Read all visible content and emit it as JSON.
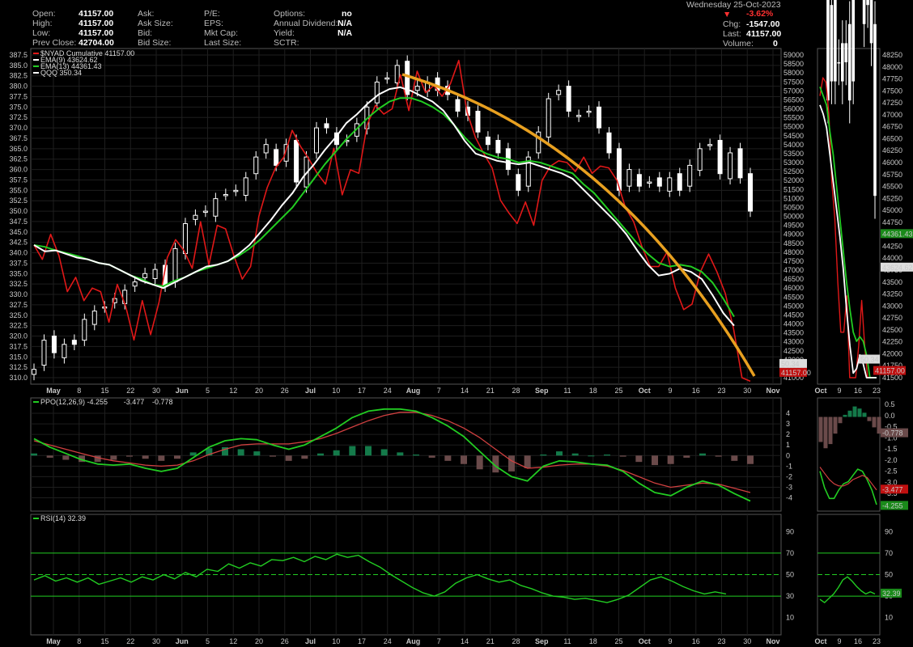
{
  "header": {
    "fields": [
      {
        "label": "Open:",
        "value": "41157.00"
      },
      {
        "label": "High:",
        "value": "41157.00"
      },
      {
        "label": "Low:",
        "value": "41157.00"
      },
      {
        "label": "Prev Close:",
        "value": "42704.00"
      },
      {
        "label": "Ask:",
        "value": ""
      },
      {
        "label": "Ask Size:",
        "value": ""
      },
      {
        "label": "Bid:",
        "value": ""
      },
      {
        "label": "Bid Size:",
        "value": ""
      },
      {
        "label": "P/E:",
        "value": ""
      },
      {
        "label": "EPS:",
        "value": ""
      },
      {
        "label": "Mkt Cap:",
        "value": ""
      },
      {
        "label": "Last Size:",
        "value": ""
      },
      {
        "label": "Options:",
        "value": "no"
      },
      {
        "label": "Annual Dividend:",
        "value": "N/A"
      },
      {
        "label": "Yield:",
        "value": "N/A"
      },
      {
        "label": "SCTR:",
        "value": ""
      }
    ],
    "date": "Wednesday  25-Oct-2023",
    "change_pct": "-3.62%",
    "chg_label": "Chg:",
    "chg_value": "-1547.00",
    "last_label": "Last:",
    "last_value": "41157.00",
    "volume_label": "Volume:",
    "volume_value": "0",
    "down_color": "#ff3030"
  },
  "chart_data": [
    {
      "type": "line",
      "legend": [
        {
          "name": "$NYAD Cumulative 41157.00",
          "color": "#e01818"
        },
        {
          "name": "EMA(9) 43624.62",
          "color": "#ffffff"
        },
        {
          "name": "EMA(13) 44361.43",
          "color": "#22cc22"
        },
        {
          "name": "QQQ 350.34",
          "color": "#ffffff"
        }
      ],
      "x_labels": [
        "May",
        "8",
        "15",
        "22",
        "30",
        "Jun",
        "5",
        "12",
        "20",
        "26",
        "Jul",
        "10",
        "17",
        "24",
        "Aug",
        "7",
        "14",
        "21",
        "28",
        "Sep",
        "11",
        "18",
        "25",
        "Oct",
        "9",
        "16",
        "23",
        "30",
        "Nov"
      ],
      "left_axis": {
        "ylim": [
          310.0,
          387.5
        ],
        "ticks": [
          "387.5",
          "385.0",
          "382.5",
          "380.0",
          "377.5",
          "375.0",
          "372.5",
          "370.0",
          "367.5",
          "365.0",
          "362.5",
          "360.0",
          "357.5",
          "355.0",
          "352.5",
          "350.0",
          "347.5",
          "345.0",
          "342.5",
          "340.0",
          "337.5",
          "335.0",
          "332.5",
          "330.0",
          "327.5",
          "325.0",
          "322.5",
          "320.0",
          "317.5",
          "315.0",
          "312.5",
          "310.0"
        ]
      },
      "right_axis": {
        "ylim": [
          41000,
          59000
        ],
        "ticks": [
          "59000",
          "58500",
          "58000",
          "57500",
          "57000",
          "56500",
          "56000",
          "55500",
          "55000",
          "54500",
          "54000",
          "53500",
          "53000",
          "52500",
          "52000",
          "51500",
          "51000",
          "50500",
          "50000",
          "49500",
          "49000",
          "48500",
          "48000",
          "47500",
          "47000",
          "46500",
          "46000",
          "45500",
          "45000",
          "44500",
          "44000",
          "43500",
          "43000",
          "42500",
          "42000",
          "41500",
          "41000"
        ]
      },
      "nyad_markers": [
        "50.34",
        "41157.00"
      ],
      "series": [
        {
          "name": "$NYAD Cumulative",
          "values": [
            48400,
            47600,
            49000,
            47800,
            45800,
            46600,
            45300,
            46000,
            45800,
            44100,
            46200,
            45000,
            43100,
            45300,
            43400,
            45200,
            47700,
            48700,
            48100,
            47100,
            49700,
            47300,
            49500,
            49300,
            47800,
            46500,
            47200,
            50000,
            51600,
            52700,
            53300,
            54800,
            53900,
            53200,
            52400,
            51800,
            53800,
            51200,
            52600,
            52400,
            55100,
            56200,
            55700,
            56000,
            57900,
            55900,
            58100,
            56900,
            57300,
            56700,
            57400,
            58700,
            55800,
            54400,
            53500,
            52700,
            50900,
            50200,
            49600,
            50800,
            49500,
            52000,
            52800,
            53100,
            53000,
            52500,
            53300,
            52400,
            52800,
            52700,
            52000,
            50500,
            49700,
            48300,
            47200,
            47200,
            48000,
            46000,
            44800,
            45100,
            46900,
            47900,
            46900,
            45700,
            43700,
            41000,
            40800
          ],
          "color": "#e01818"
        },
        {
          "name": "EMA(9)",
          "values": [
            48400,
            48050,
            48100,
            47900,
            47700,
            47600,
            47400,
            47300,
            47000,
            46700,
            46400,
            46200,
            46000,
            46300,
            46600,
            46900,
            47200,
            47300,
            47500,
            47900,
            48400,
            49100,
            49800,
            50600,
            51300,
            52200,
            52900,
            53700,
            54400,
            55200,
            55700,
            56300,
            56800,
            57100,
            57200,
            57000,
            56700,
            56400,
            55900,
            55100,
            54200,
            53500,
            53300,
            53100,
            53000,
            52900,
            53000,
            52800,
            52600,
            52400,
            52100,
            51500,
            50900,
            50300,
            49700,
            49000,
            48100,
            47300,
            46700,
            46800,
            47100,
            46900,
            46500,
            45600,
            44600,
            43900
          ],
          "color": "#ffffff"
        },
        {
          "name": "EMA(13)",
          "values": [
            48400,
            48300,
            48100,
            47950,
            47800,
            47600,
            47400,
            47300,
            47000,
            46700,
            46500,
            46200,
            46100,
            46400,
            46600,
            46900,
            47100,
            47300,
            47500,
            47800,
            48200,
            48700,
            49300,
            49900,
            50500,
            51300,
            52100,
            52900,
            53600,
            54300,
            54900,
            55500,
            56000,
            56400,
            56600,
            56600,
            56400,
            56100,
            55700,
            55100,
            54400,
            53800,
            53500,
            53300,
            53200,
            53000,
            53100,
            53000,
            52800,
            52600,
            52400,
            51800,
            51300,
            50600,
            49900,
            49200,
            48500,
            47900,
            47400,
            47200,
            47300,
            47200,
            46900,
            46300,
            45400,
            44400
          ],
          "color": "#22cc22"
        },
        {
          "name": "QQQ",
          "type": "candlestick",
          "close": [
            312,
            319,
            316,
            318,
            318,
            324,
            326,
            327,
            329,
            331,
            333,
            335,
            336,
            332,
            341,
            347,
            349,
            350,
            353,
            354,
            355,
            358,
            363,
            366,
            361,
            366,
            357,
            363,
            370,
            370,
            366,
            367,
            371,
            375,
            381,
            382,
            385,
            378,
            380,
            381,
            379,
            378,
            374,
            373,
            369,
            366,
            364,
            360,
            355,
            363,
            369,
            377,
            379,
            374,
            373,
            374,
            370,
            364,
            355,
            360,
            356,
            357,
            356,
            358,
            355,
            361,
            365,
            366,
            359,
            364,
            358,
            350
          ],
          "color": "#ffffff"
        }
      ]
    },
    {
      "type": "line",
      "legend": [
        {
          "name": "PPO(12,26,9) -4.255",
          "color": "#22cc22"
        },
        {
          "name": "-3.477",
          "color": "#e04040"
        },
        {
          "name": "-0.778",
          "color": "#22aa66"
        }
      ],
      "ylim": [
        -4.8,
        5.0
      ],
      "right_ticks": [
        "4",
        "3",
        "2",
        "1",
        "0",
        "-1",
        "-2",
        "-3",
        "-4"
      ],
      "markers": [
        "-0.778",
        "-3.477",
        "-4.255"
      ],
      "series": [
        {
          "name": "PPO",
          "values": [
            1.6,
            0.8,
            0.2,
            -0.4,
            -0.8,
            -0.9,
            -0.8,
            -1.2,
            -1.5,
            -1.2,
            -0.2,
            0.8,
            1.4,
            1.6,
            1.5,
            1.0,
            0.6,
            1.0,
            1.8,
            2.6,
            3.6,
            4.2,
            4.4,
            4.4,
            4.2,
            3.6,
            2.8,
            1.8,
            0.4,
            -1.0,
            -2.0,
            -2.4,
            -1.0,
            -0.5,
            -0.6,
            -0.8,
            -0.9,
            -1.5,
            -2.6,
            -3.5,
            -3.8,
            -3.0,
            -2.4,
            -2.8,
            -3.6,
            -4.3
          ],
          "color": "#22cc22"
        },
        {
          "name": "Signal",
          "values": [
            1.4,
            1.0,
            0.6,
            0.2,
            -0.2,
            -0.5,
            -0.7,
            -0.9,
            -1.0,
            -0.9,
            -0.5,
            0.1,
            0.6,
            1.0,
            1.1,
            1.1,
            1.1,
            1.3,
            1.6,
            2.1,
            2.7,
            3.3,
            3.8,
            4.1,
            4.1,
            3.8,
            3.3,
            2.6,
            1.7,
            0.6,
            -0.5,
            -1.2,
            -1.1,
            -0.9,
            -0.8,
            -0.8,
            -1.0,
            -1.4,
            -2.0,
            -2.6,
            -3.0,
            -2.8,
            -2.6,
            -2.7,
            -3.1,
            -3.5
          ],
          "color": "#d04040"
        },
        {
          "name": "Histogram",
          "values": [
            0.2,
            -0.2,
            -0.4,
            -0.6,
            -0.6,
            -0.4,
            -0.1,
            -0.3,
            -0.5,
            -0.3,
            0.3,
            0.7,
            0.8,
            0.6,
            0.4,
            -0.1,
            -0.5,
            -0.3,
            0.2,
            0.5,
            0.9,
            0.9,
            0.6,
            0.3,
            0.1,
            -0.2,
            -0.5,
            -0.8,
            -1.3,
            -1.6,
            -1.5,
            -1.2,
            0.1,
            0.4,
            0.2,
            0.0,
            0.1,
            -0.1,
            -0.6,
            -0.9,
            -0.8,
            -0.2,
            0.2,
            -0.1,
            -0.5,
            -0.8
          ],
          "type": "histogram"
        }
      ]
    },
    {
      "type": "line",
      "legend": [
        {
          "name": "RSI(14) 32.39",
          "color": "#22cc22"
        }
      ],
      "ylim": [
        0,
        100
      ],
      "right_ticks": [
        "90",
        "70",
        "50",
        "30",
        "10"
      ],
      "reference_lines": [
        70,
        50,
        30
      ],
      "marker": "32.39",
      "series": [
        {
          "name": "RSI(14)",
          "values": [
            45,
            49,
            44,
            47,
            43,
            47,
            41,
            44,
            47,
            43,
            48,
            45,
            50,
            46,
            52,
            48,
            55,
            53,
            60,
            56,
            61,
            58,
            64,
            63,
            66,
            62,
            67,
            64,
            69,
            66,
            68,
            62,
            57,
            50,
            44,
            38,
            33,
            30,
            34,
            42,
            47,
            50,
            46,
            43,
            45,
            40,
            37,
            33,
            30,
            29,
            27,
            28,
            26,
            24,
            27,
            31,
            38,
            45,
            48,
            44,
            39,
            35,
            32,
            34,
            32
          ],
          "color": "#22cc22"
        }
      ]
    },
    {
      "type": "line",
      "inset": true,
      "x_labels": [
        "Oct",
        "9",
        "16",
        "23"
      ],
      "right_ticks": [
        "48250",
        "48000",
        "47750",
        "47500",
        "47250",
        "47000",
        "46750",
        "46500",
        "46250",
        "46000",
        "45750",
        "45500",
        "45250",
        "45000",
        "44750",
        "44500",
        "44250",
        "44000",
        "43750",
        "43500",
        "43250",
        "43000",
        "42750",
        "42500",
        "42250",
        "42000",
        "41750",
        "41500"
      ],
      "markers": [
        "44361.43",
        "43624.62",
        "50.34",
        "41157.00"
      ],
      "ppo_ticks": [
        "0.5",
        "0.0",
        "-0.5",
        "-1.0",
        "-1.5",
        "-2.0",
        "-2.5",
        "-3.0",
        "-3.5",
        "-4.0"
      ],
      "ppo_markers": [
        "-0.778",
        "-3.477",
        "-4.255"
      ],
      "rsi_ticks": [
        "90",
        "70",
        "50",
        "30",
        "10"
      ],
      "rsi_marker": "32.39"
    }
  ]
}
